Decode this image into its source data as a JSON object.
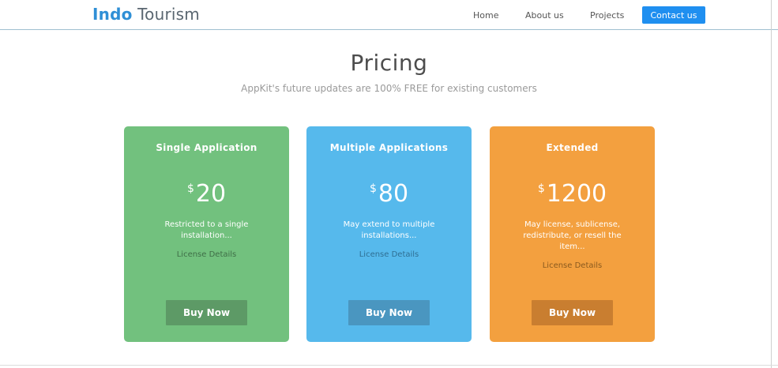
{
  "brand": {
    "strong": "Indo",
    "light": "Tourism"
  },
  "nav": {
    "items": [
      {
        "label": "Home"
      },
      {
        "label": "About us"
      },
      {
        "label": "Projects"
      }
    ],
    "contact_label": "Contact us"
  },
  "pricing": {
    "title": "Pricing",
    "subtitle": "AppKit's future updates are 100% FREE for existing customers",
    "plans": [
      {
        "name": "Single Application",
        "currency": "$",
        "price": "20",
        "description": "Restricted to a single installation...",
        "license_link": "License Details",
        "buy_label": "Buy Now",
        "color": "#72c17e"
      },
      {
        "name": "Multiple Applications",
        "currency": "$",
        "price": "80",
        "description": "May extend to multiple installations...",
        "license_link": "License Details",
        "buy_label": "Buy Now",
        "color": "#56b9ec"
      },
      {
        "name": "Extended",
        "currency": "$",
        "price": "1200",
        "description": "May license, sublicense, redistribute, or resell the item...",
        "license_link": "License Details",
        "buy_label": "Buy Now",
        "color": "#f3a03f"
      }
    ]
  },
  "colors": {
    "brand_blue": "#2f8fd6",
    "contact_button": "#1f8ff0"
  }
}
